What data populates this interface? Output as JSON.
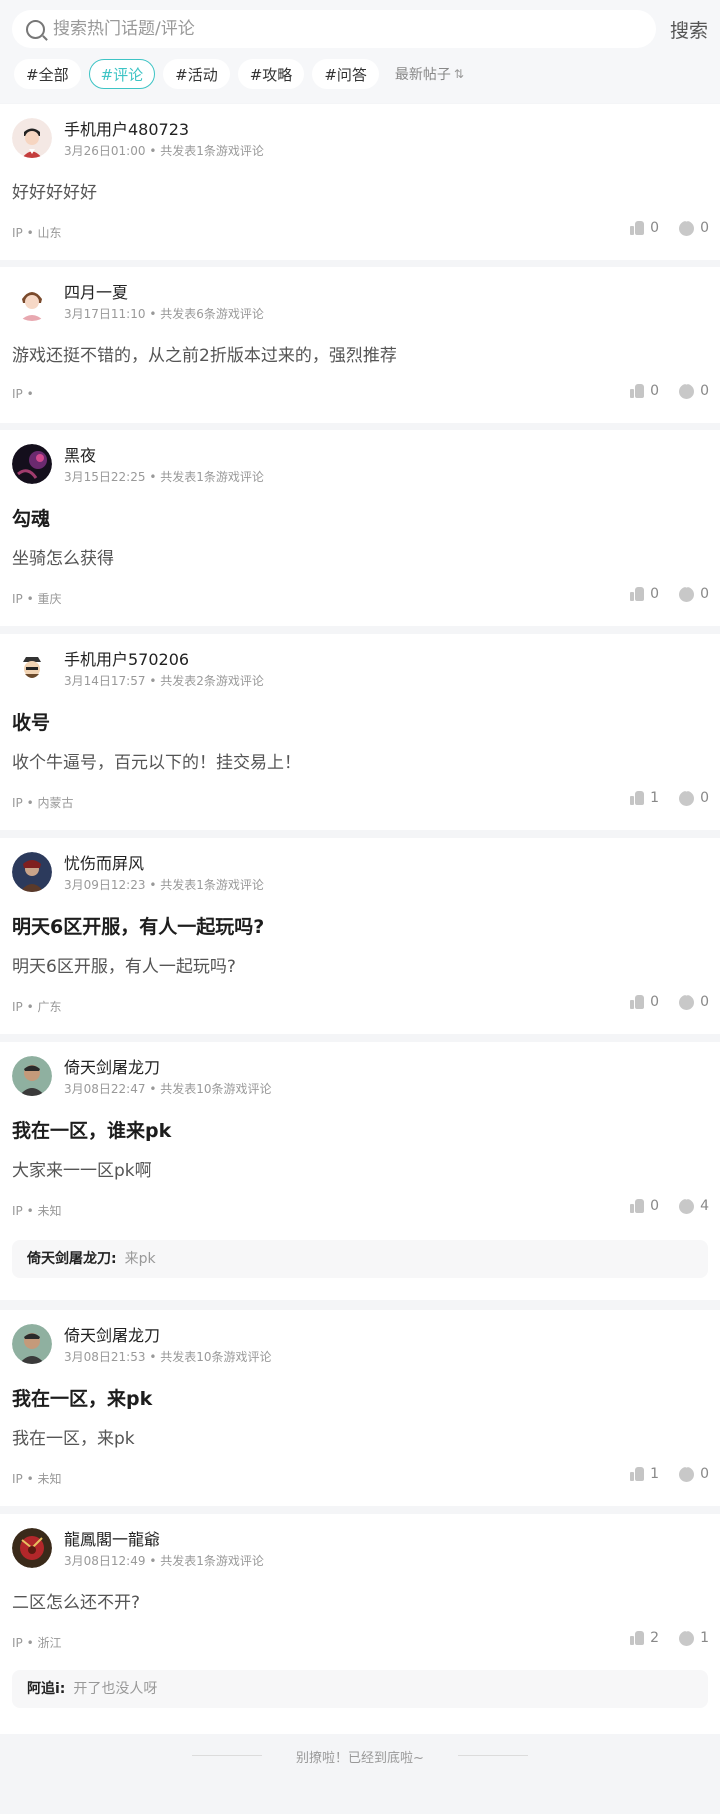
{
  "search": {
    "placeholder": "搜索热门话题/评论",
    "button_label": "搜索"
  },
  "filters": {
    "tabs": [
      "#全部",
      "#评论",
      "#活动",
      "#攻略",
      "#问答"
    ],
    "active_index": 1,
    "sort_label": "最新帖子"
  },
  "posts": [
    {
      "user": "手机用户480723",
      "date": "3月26日01:00",
      "post_count": "共发表1条游戏评论",
      "title": "",
      "body": "好好好好好",
      "ip": "山东",
      "likes": "0",
      "comments": "0"
    },
    {
      "user": "四月一夏",
      "date": "3月17日11:10",
      "post_count": "共发表6条游戏评论",
      "title": "",
      "body": "游戏还挺不错的，从之前2折版本过来的，强烈推荐",
      "ip": "",
      "likes": "0",
      "comments": "0"
    },
    {
      "user": "黑夜",
      "date": "3月15日22:25",
      "post_count": "共发表1条游戏评论",
      "title": "勾魂",
      "body": "坐骑怎么获得",
      "ip": "重庆",
      "likes": "0",
      "comments": "0"
    },
    {
      "user": "手机用户570206",
      "date": "3月14日17:57",
      "post_count": "共发表2条游戏评论",
      "title": "收号",
      "body": "收个牛逼号，百元以下的！挂交易上！",
      "ip": "内蒙古",
      "likes": "1",
      "comments": "0"
    },
    {
      "user": "忧伤而屏风",
      "date": "3月09日12:23",
      "post_count": "共发表1条游戏评论",
      "title": "明天6区开服，有人一起玩吗?",
      "body": "明天6区开服，有人一起玩吗?",
      "ip": "广东",
      "likes": "0",
      "comments": "0"
    },
    {
      "user": "倚天剑屠龙刀",
      "date": "3月08日22:47",
      "post_count": "共发表10条游戏评论",
      "title": "我在一区，谁来pk",
      "body": "大家来一一区pk啊",
      "ip": "未知",
      "likes": "0",
      "comments": "4",
      "reply": {
        "author": "倚天剑屠龙刀:",
        "text": "来pk"
      }
    },
    {
      "user": "倚天剑屠龙刀",
      "date": "3月08日21:53",
      "post_count": "共发表10条游戏评论",
      "title": "我在一区，来pk",
      "body": "我在一区，来pk",
      "ip": "未知",
      "likes": "1",
      "comments": "0"
    },
    {
      "user": "龍鳳閣一龍爺",
      "date": "3月08日12:49",
      "post_count": "共发表1条游戏评论",
      "title": "",
      "body": "二区怎么还不开?",
      "ip": "浙江",
      "likes": "2",
      "comments": "1",
      "reply": {
        "author": "阿追i:",
        "text": "开了也没人呀"
      }
    }
  ],
  "labels": {
    "ip_prefix": "IP •",
    "dot": "•"
  },
  "footer": {
    "end_text": "别撩啦！已经到底啦~"
  },
  "colors": {
    "accent": "#3ec4c5",
    "page_bg": "#f4f5f7",
    "card_bg": "#ffffff"
  }
}
